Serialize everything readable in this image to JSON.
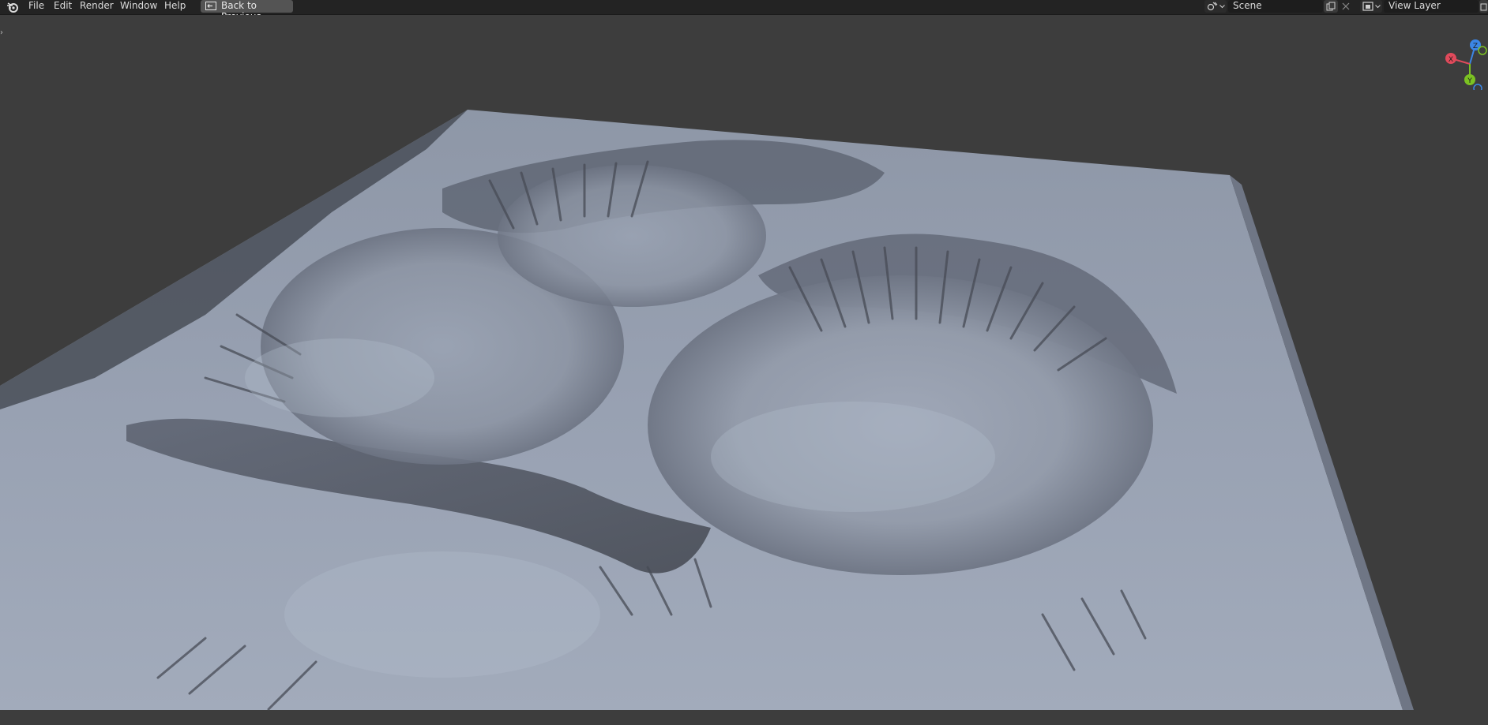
{
  "menubar": {
    "app_icon": "blender-logo-icon",
    "items": [
      "File",
      "Edit",
      "Render",
      "Window",
      "Help"
    ],
    "back_button": {
      "label": "Back to Previous",
      "icon": "back-window-icon"
    }
  },
  "scene_selector": {
    "icon": "scene-icon",
    "value": "Scene",
    "copy_icon": "duplicate-icon",
    "close_icon": "close-icon"
  },
  "view_layer_selector": {
    "icon": "view-layer-icon",
    "value": "View Layer",
    "copy_icon": "duplicate-icon"
  },
  "viewport": {
    "sidebar_toggle": "›",
    "gizmo": {
      "x_label": "X",
      "y_label": "Y",
      "z_label": "Z"
    },
    "colors": {
      "background": "#3d3d3d",
      "terrain_light": "#9aa3b3",
      "terrain_shadow": "#3a3c42",
      "axis_x": "#e04a5b",
      "axis_y": "#7bc222",
      "axis_z": "#3b86e6"
    }
  }
}
